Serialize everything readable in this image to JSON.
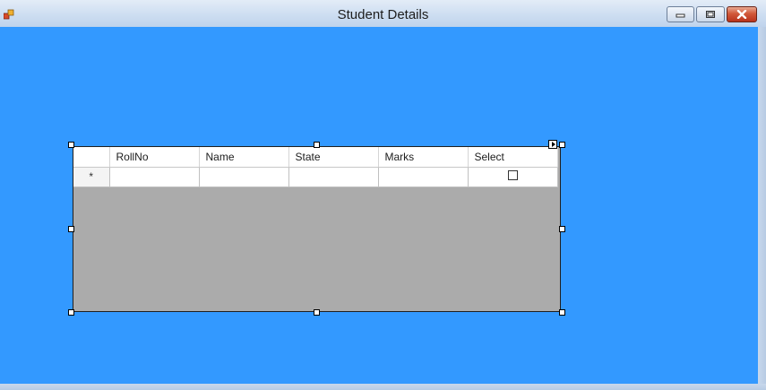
{
  "window": {
    "title": "Student Details"
  },
  "titlebar_buttons": {
    "minimize": "minimize-icon",
    "maximize": "maximize-icon",
    "close": "close-icon"
  },
  "grid": {
    "columns": [
      "RollNo",
      "Name",
      "State",
      "Marks",
      "Select"
    ],
    "new_row_marker": "*"
  },
  "colors": {
    "client_background": "#3399ff",
    "grid_background": "#ababab",
    "close_button": "#c8452a"
  }
}
